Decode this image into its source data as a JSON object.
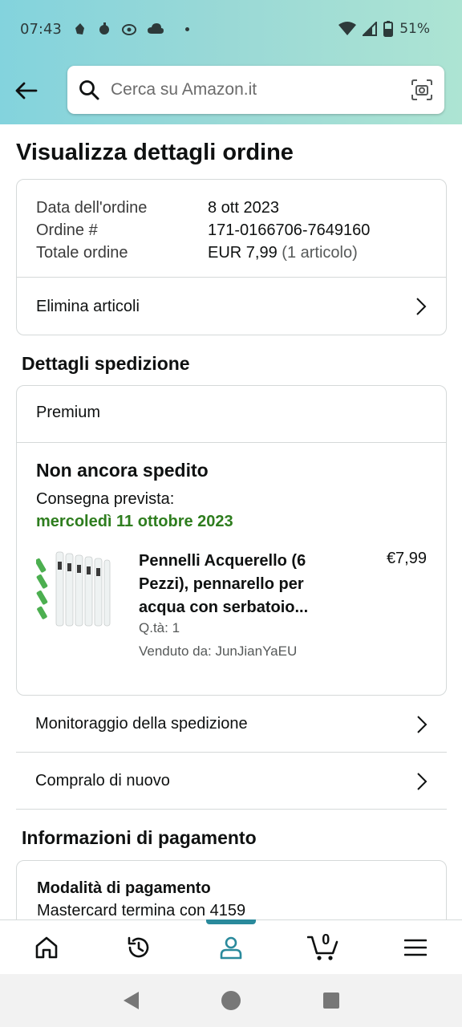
{
  "status_bar": {
    "time": "07:43",
    "battery": "51%"
  },
  "search": {
    "placeholder": "Cerca su Amazon.it"
  },
  "page": {
    "title": "Visualizza dettagli ordine"
  },
  "order_summary": {
    "rows": [
      {
        "label": "Data dell'ordine",
        "value": "8 ott 2023"
      },
      {
        "label": "Ordine #",
        "value": "171-0166706-7649160"
      },
      {
        "label": "Totale ordine",
        "value": "EUR 7,99",
        "extra": "(1 articolo)"
      }
    ],
    "delete_items": "Elimina articoli"
  },
  "shipping": {
    "heading": "Dettagli spedizione",
    "method": "Premium",
    "status": "Non ancora spedito",
    "delivery_label": "Consegna prevista:",
    "delivery_date": "mercoledì 11 ottobre 2023",
    "product": {
      "name": "Pennelli Acquerello (6 Pezzi), pennarello per acqua con serbatoio...",
      "price": "€7,99",
      "qty": "Q.tà: 1",
      "seller": "Venduto da: JunJianYaEU"
    },
    "track": "Monitoraggio della spedizione",
    "buy_again": "Compralo di nuovo"
  },
  "payment": {
    "heading": "Informazioni di pagamento",
    "method_label": "Modalità di pagamento",
    "method_value": "Mastercard  termina con 4159"
  },
  "bottom_nav": {
    "items": [
      "home-icon",
      "history-icon",
      "account-icon",
      "cart-icon",
      "menu-icon"
    ],
    "active": "account-icon",
    "cart_count": "0"
  },
  "colors": {
    "accent": "#2a8a9c",
    "delivery_green": "#2e7d1e"
  }
}
